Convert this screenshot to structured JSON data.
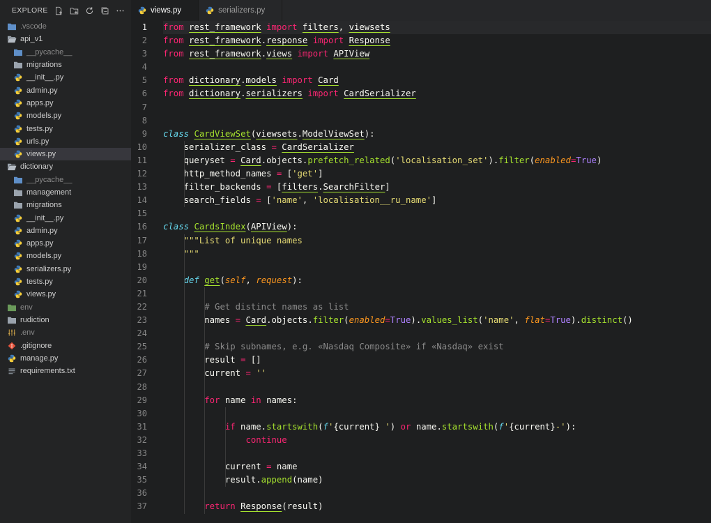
{
  "explorer": {
    "title": "EXPLORE...",
    "actions": [
      "new-file-icon",
      "new-folder-icon",
      "refresh-icon",
      "collapse-all-icon",
      "more-icon"
    ],
    "tree": [
      {
        "label": ".vscode",
        "type": "folder-blue",
        "depth": 0,
        "dim": true
      },
      {
        "label": "api_v1",
        "type": "folder-open",
        "depth": 0
      },
      {
        "label": "__pycache__",
        "type": "folder-blue",
        "depth": 1,
        "dim": true
      },
      {
        "label": "migrations",
        "type": "folder",
        "depth": 1
      },
      {
        "label": "__init__.py",
        "type": "python",
        "depth": 1
      },
      {
        "label": "admin.py",
        "type": "python",
        "depth": 1
      },
      {
        "label": "apps.py",
        "type": "python",
        "depth": 1
      },
      {
        "label": "models.py",
        "type": "python",
        "depth": 1
      },
      {
        "label": "tests.py",
        "type": "python",
        "depth": 1
      },
      {
        "label": "urls.py",
        "type": "python",
        "depth": 1
      },
      {
        "label": "views.py",
        "type": "python",
        "depth": 1,
        "selected": true
      },
      {
        "label": "dictionary",
        "type": "folder-open",
        "depth": 0
      },
      {
        "label": "__pycache__",
        "type": "folder-blue",
        "depth": 1,
        "dim": true
      },
      {
        "label": "management",
        "type": "folder",
        "depth": 1
      },
      {
        "label": "migrations",
        "type": "folder",
        "depth": 1
      },
      {
        "label": "__init__.py",
        "type": "python",
        "depth": 1
      },
      {
        "label": "admin.py",
        "type": "python",
        "depth": 1
      },
      {
        "label": "apps.py",
        "type": "python",
        "depth": 1
      },
      {
        "label": "models.py",
        "type": "python",
        "depth": 1
      },
      {
        "label": "serializers.py",
        "type": "python",
        "depth": 1
      },
      {
        "label": "tests.py",
        "type": "python",
        "depth": 1
      },
      {
        "label": "views.py",
        "type": "python",
        "depth": 1
      },
      {
        "label": "env",
        "type": "folder-green",
        "depth": 0,
        "dim": true
      },
      {
        "label": "rudiction",
        "type": "folder",
        "depth": 0
      },
      {
        "label": ".env",
        "type": "settings",
        "depth": 0,
        "dim": true
      },
      {
        "label": ".gitignore",
        "type": "git",
        "depth": 0
      },
      {
        "label": "manage.py",
        "type": "python",
        "depth": 0
      },
      {
        "label": "requirements.txt",
        "type": "text",
        "depth": 0
      }
    ]
  },
  "tabs": [
    {
      "label": "views.py",
      "active": true
    },
    {
      "label": "serializers.py",
      "active": false
    }
  ],
  "editor": {
    "current_line": 1,
    "lines": [
      "from rest_framework import filters, viewsets",
      "from rest_framework.response import Response",
      "from rest_framework.views import APIView",
      "",
      "from dictionary.models import Card",
      "from dictionary.serializers import CardSerializer",
      "",
      "",
      "class CardViewSet(viewsets.ModelViewSet):",
      "    serializer_class = CardSerializer",
      "    queryset = Card.objects.prefetch_related('localisation_set').filter(enabled=True)",
      "    http_method_names = ['get']",
      "    filter_backends = [filters.SearchFilter]",
      "    search_fields = ['name', 'localisation__ru_name']",
      "",
      "class CardsIndex(APIView):",
      "    \"\"\"List of unique names",
      "    \"\"\"",
      "",
      "    def get(self, request):",
      "",
      "        # Get distinct names as list",
      "        names = Card.objects.filter(enabled=True).values_list('name', flat=True).distinct()",
      "",
      "        # Skip subnames, e.g. «Nasdaq Composite» if «Nasdaq» exist",
      "        result = []",
      "        current = ''",
      "",
      "        for name in names:",
      "",
      "            if name.startswith(f'{current} ') or name.startswith(f'{current}-'):",
      "                continue",
      "",
      "            current = name",
      "            result.append(name)",
      "",
      "        return Response(result)"
    ]
  }
}
